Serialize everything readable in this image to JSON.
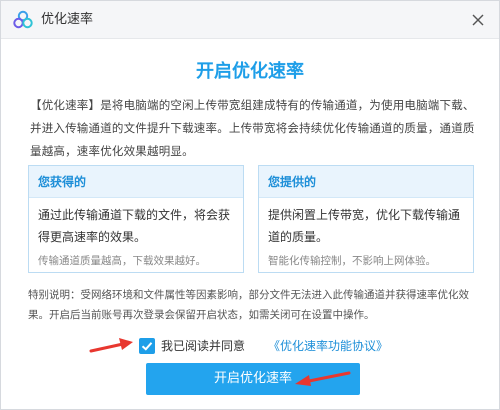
{
  "window": {
    "title": "优化速率",
    "icon": "cloud-logo-icon",
    "close_icon": "close-icon"
  },
  "dialog": {
    "heading": "开启优化速率",
    "description": "【优化速率】是将电脑端的空闲上传带宽组建成特有的传输通道，为使用电脑端下载、并进入传输通道的文件提升下载速率。上传带宽将会持续优化传输通道的质量，通道质量越高，速率优化效果越明显。",
    "cards": [
      {
        "title": "您获得的",
        "body": "通过此传输通道下载的文件，将会获得更高速率的效果。",
        "note": "传输通道质量越高，下载效果越好。"
      },
      {
        "title": "您提供的",
        "body": "提供闲置上传带宽，优化下载传输通道的质量。",
        "note": "智能化传输控制，不影响上网体验。"
      }
    ],
    "notice": "特别说明：受网络环境和文件属性等因素影响，部分文件无法进入此传输通道并获得速率优化效果。开启后当前账号再次登录会保留开启状态，如需关闭可在设置中操作。",
    "agreement": {
      "checked": true,
      "text": "我已阅读并同意",
      "link": "《优化速率功能协议》"
    },
    "primary_button": "开启优化速率"
  },
  "colors": {
    "accent": "#1e9ee8",
    "button": "#23a4ee",
    "card_border": "#bcdcf3",
    "card_header_bg": "#e9f4fd",
    "annotation_arrow": "#e8372f"
  }
}
